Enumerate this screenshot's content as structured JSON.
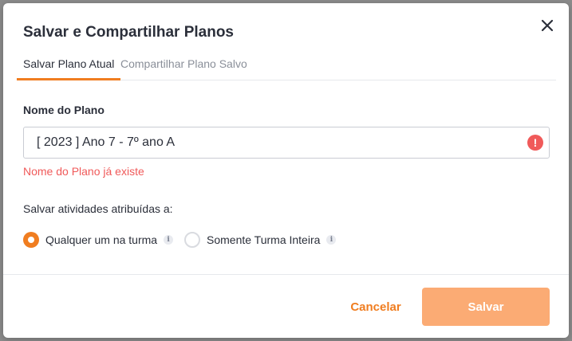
{
  "dialog": {
    "title": "Salvar e Compartilhar Planos",
    "close_icon": "close-icon"
  },
  "tabs": [
    {
      "label": "Salvar Plano Atual",
      "active": true
    },
    {
      "label": "Compartilhar Plano Salvo",
      "active": false
    }
  ],
  "form": {
    "plan_name_label": "Nome do Plano",
    "plan_name_value": "[ 2023 ] Ano 7 - 7º ano A",
    "error_icon": "!",
    "error_message": "Nome do Plano já existe",
    "assign_label": "Salvar atividades atribuídas a:",
    "options": [
      {
        "label": "Qualquer um na turma",
        "checked": true,
        "info_icon": "i"
      },
      {
        "label": "Somente Turma Inteira",
        "checked": false,
        "info_icon": "i"
      }
    ]
  },
  "footer": {
    "cancel_label": "Cancelar",
    "save_label": "Salvar"
  },
  "colors": {
    "accent": "#f07d20",
    "save_button": "#fbab74",
    "error": "#f05a5a",
    "text": "#2b2f3a"
  }
}
